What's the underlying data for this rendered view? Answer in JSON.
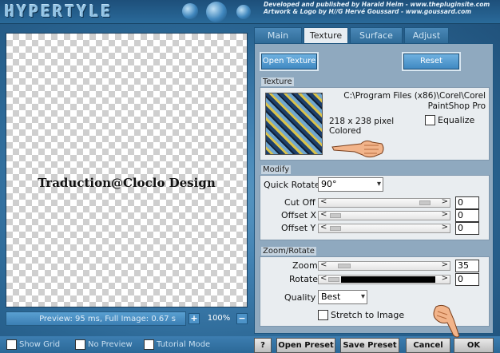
{
  "header": {
    "logo": "HYPERTYLE",
    "credits_line1": "Developed and published by Harald Heim - www.thepluginsite.com",
    "credits_line2": "Artwork & Logo by H//G Hervé Goussard - www.goussard.com"
  },
  "preview": {
    "watermark": "Traduction@Cloclo Design",
    "status": "Preview: 95 ms, Full Image: 0.67 s",
    "zoom_in": "+",
    "zoom_level": "100%",
    "zoom_out": "−"
  },
  "tabs": [
    {
      "label": "Main"
    },
    {
      "label": "Texture"
    },
    {
      "label": "Surface"
    },
    {
      "label": "Adjust"
    }
  ],
  "texture_panel": {
    "open_texture_label": "Open Texture",
    "reset_label": "Reset",
    "section_texture": "Texture",
    "texture_path": "C:\\Program Files (x86)\\Corel\\Corel PaintShop Pro",
    "texture_size": "218 x 238 pixel",
    "texture_mode": "Colored",
    "equalize_label": "Equalize",
    "section_modify": "Modify",
    "quick_rotate_label": "Quick Rotate",
    "quick_rotate_value": "90°",
    "cut_off_label": "Cut Off",
    "cut_off_value": "0",
    "offset_x_label": "Offset X",
    "offset_x_value": "0",
    "offset_y_label": "Offset Y",
    "offset_y_value": "0",
    "section_zoom": "Zoom/Rotate",
    "zoom_label": "Zoom",
    "zoom_value": "35",
    "rotate_label": "Rotate",
    "rotate_value": "0",
    "quality_label": "Quality",
    "quality_value": "Best",
    "stretch_label": "Stretch to Image"
  },
  "bottom": {
    "show_grid": "Show Grid",
    "no_preview": "No Preview",
    "tutorial_mode": "Tutorial Mode",
    "help": "?",
    "open_preset": "Open Preset",
    "save_preset": "Save Preset",
    "cancel": "Cancel",
    "ok": "OK"
  },
  "colors": {
    "accent": "#4089c2",
    "panel_bg": "#8fa9bf"
  }
}
